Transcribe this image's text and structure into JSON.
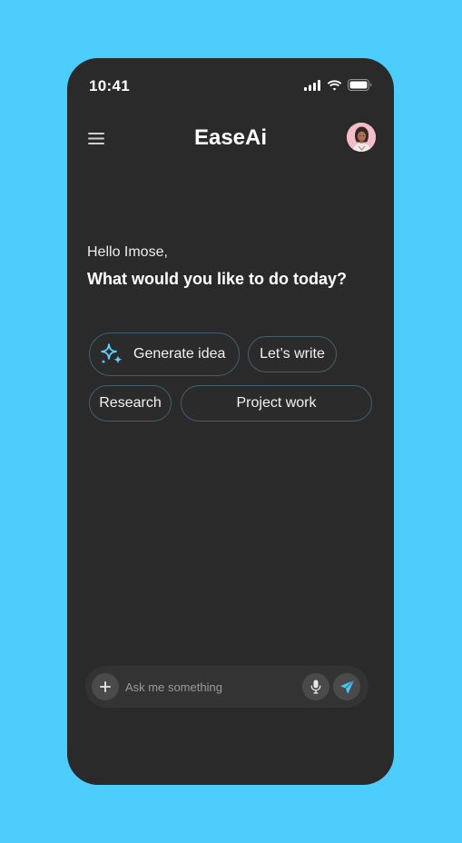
{
  "status_bar": {
    "time": "10:41",
    "icons": [
      "cellular-signal-icon",
      "wifi-icon",
      "battery-icon"
    ]
  },
  "header": {
    "menu_icon": "hamburger-menu-icon",
    "title": "EaseAi",
    "avatar": "user-avatar"
  },
  "greeting": {
    "hello": "Hello Imose,",
    "question": "What would you like to do today?"
  },
  "suggestions": [
    {
      "label": "Generate idea",
      "icon": "sparkles-icon"
    },
    {
      "label": "Let’s write"
    },
    {
      "label": "Research"
    },
    {
      "label": "Project work"
    }
  ],
  "composer": {
    "placeholder": "Ask me something",
    "value": "",
    "add_icon": "plus-icon",
    "mic_icon": "microphone-icon",
    "send_icon": "send-icon"
  },
  "colors": {
    "background": "#4ccdfc",
    "phone": "#2a2a2a",
    "chip_border": "#43606d",
    "accent": "#4cc3f5"
  }
}
